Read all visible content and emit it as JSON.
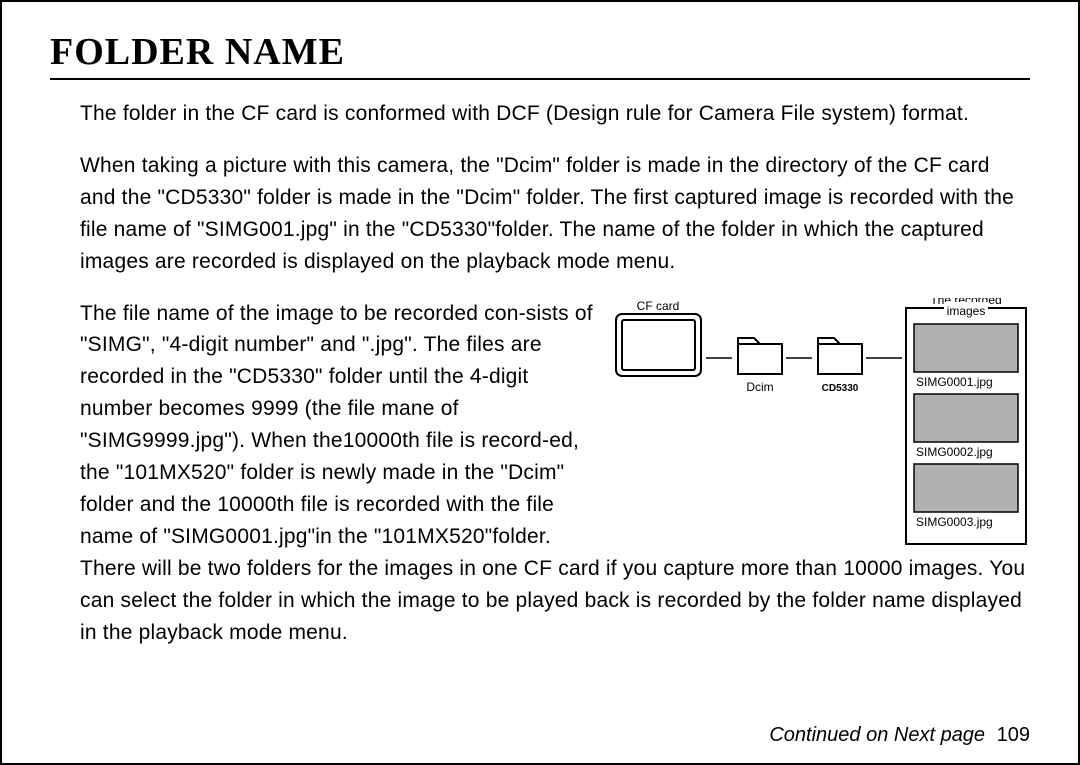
{
  "heading": "FOLDER NAME",
  "para1": "The folder in the CF card is conformed with DCF (Design rule for Camera File system) format.",
  "para2": "When taking a picture with this camera, the \"Dcim\" folder is made in the directory of the CF card and the \"CD5330\" folder is made in the \"Dcim\" folder. The first captured image is recorded with the file name of \"SIMG001.jpg\" in the \"CD5330\"folder. The name of the folder in which the captured images are recorded is displayed on the playback mode menu.",
  "para3": "The file name of the image to be recorded con-sists of \"SIMG\", \"4-digit number\" and \".jpg\". The files are recorded in the \"CD5330\" folder until the 4-digit number becomes 9999 (the file mane of \"SIMG9999.jpg\"). When the10000th file is record-ed, the \"101MX520\" folder is newly made in the \"Dcim\" folder and the 10000th file is recorded with the file name of \"SIMG0001.jpg\"in the \"101MX520\"folder.",
  "para4": "There will be two folders for the images in one CF card if you capture more than 10000 images. You can select the folder in which the image to be played back is recorded by the folder name displayed in the playback mode menu.",
  "diagram": {
    "cf_card_label": "CF card",
    "dcim_label": "Dcim",
    "cd5330_label": "CD5330",
    "right_title": "The recorded",
    "right_subtitle": "images",
    "file1": "SIMG0001.jpg",
    "file2": "SIMG0002.jpg",
    "file3": "SIMG0003.jpg"
  },
  "footer": {
    "continued": "Continued on Next page",
    "page_number": "109"
  }
}
